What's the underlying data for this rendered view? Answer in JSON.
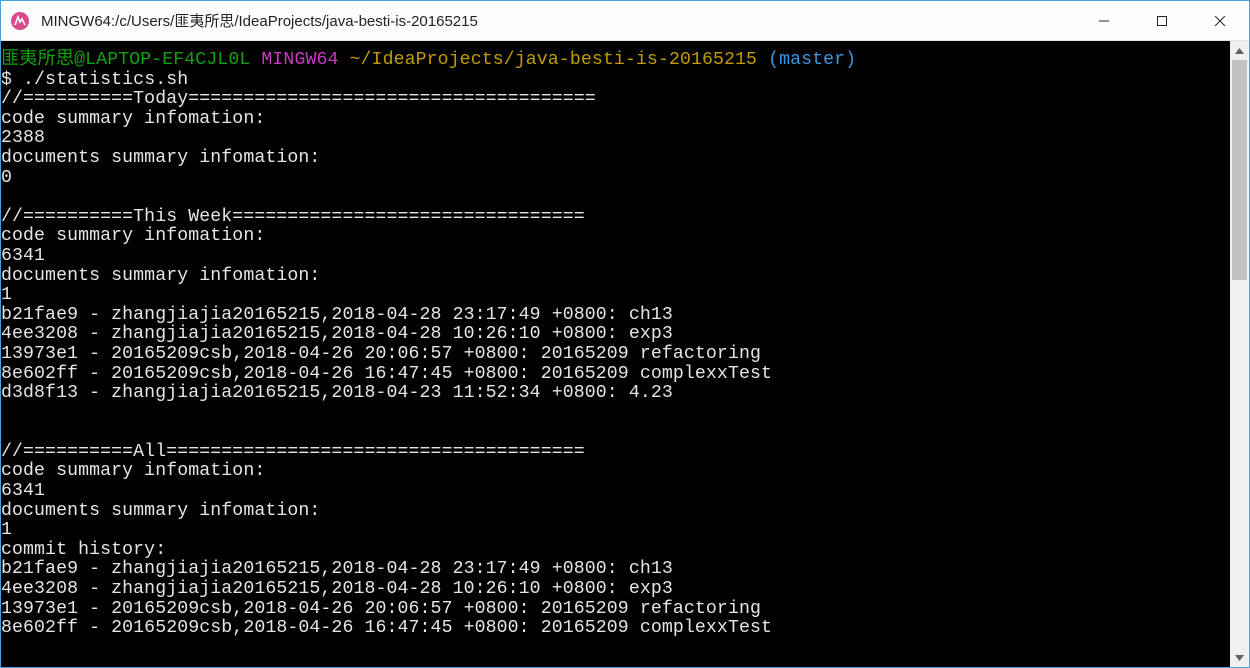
{
  "window": {
    "title": "MINGW64:/c/Users/匪夷所思/IdeaProjects/java-besti-is-20165215"
  },
  "prompt": {
    "user_host": "匪夷所思@LAPTOP-EF4CJL0L",
    "shell": "MINGW64",
    "path": "~/IdeaProjects/java-besti-is-20165215",
    "branch": "(master)",
    "symbol": "$ ",
    "command": "./statistics.sh"
  },
  "output": {
    "l01": "//==========Today=====================================",
    "l02": "code summary infomation:",
    "l03": "2388",
    "l04": "documents summary infomation:",
    "l05": "0",
    "l06": "",
    "l07": "//==========This Week================================",
    "l08": "code summary infomation:",
    "l09": "6341",
    "l10": "documents summary infomation:",
    "l11": "1",
    "l12": "b21fae9 - zhangjiajia20165215,2018-04-28 23:17:49 +0800: ch13",
    "l13": "4ee3208 - zhangjiajia20165215,2018-04-28 10:26:10 +0800: exp3",
    "l14": "13973e1 - 20165209csb,2018-04-26 20:06:57 +0800: 20165209 refactoring",
    "l15": "8e602ff - 20165209csb,2018-04-26 16:47:45 +0800: 20165209 complexxTest",
    "l16": "d3d8f13 - zhangjiajia20165215,2018-04-23 11:52:34 +0800: 4.23",
    "l17": "",
    "l18": "",
    "l19": "//==========All======================================",
    "l20": "code summary infomation:",
    "l21": "6341",
    "l22": "documents summary infomation:",
    "l23": "1",
    "l24": "commit history:",
    "l25": "b21fae9 - zhangjiajia20165215,2018-04-28 23:17:49 +0800: ch13",
    "l26": "4ee3208 - zhangjiajia20165215,2018-04-28 10:26:10 +0800: exp3",
    "l27": "13973e1 - 20165209csb,2018-04-26 20:06:57 +0800: 20165209 refactoring",
    "l28": "8e602ff - 20165209csb,2018-04-26 16:47:45 +0800: 20165209 complexxTest"
  }
}
